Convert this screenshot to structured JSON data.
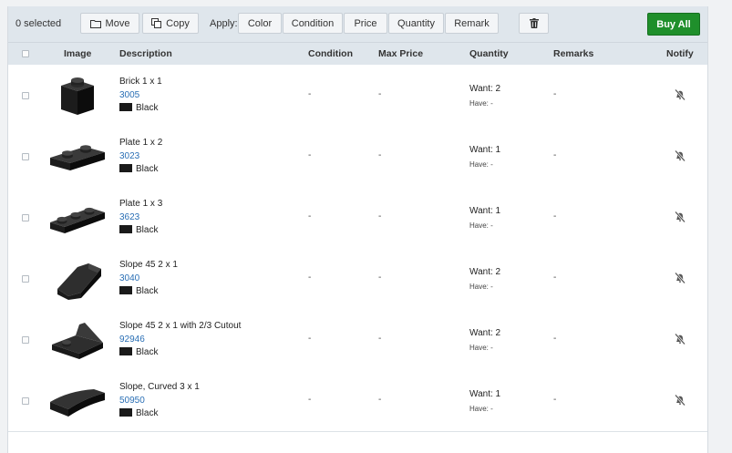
{
  "toolbar": {
    "selected_count": "0 selected",
    "move_label": "Move",
    "copy_label": "Copy",
    "apply_label": "Apply:",
    "apply_buttons": [
      "Color",
      "Condition",
      "Price",
      "Quantity",
      "Remark"
    ],
    "buy_all_label": "Buy All"
  },
  "columns": {
    "image": "Image",
    "description": "Description",
    "condition": "Condition",
    "max_price": "Max Price",
    "quantity": "Quantity",
    "remarks": "Remarks",
    "notify": "Notify"
  },
  "rows": [
    {
      "name": "Brick 1 x 1",
      "id": "3005",
      "color": "Black",
      "condition": "-",
      "max_price": "-",
      "want": "Want: 2",
      "have": "Have: -",
      "remarks": "-"
    },
    {
      "name": "Plate 1 x 2",
      "id": "3023",
      "color": "Black",
      "condition": "-",
      "max_price": "-",
      "want": "Want: 1",
      "have": "Have: -",
      "remarks": "-"
    },
    {
      "name": "Plate 1 x 3",
      "id": "3623",
      "color": "Black",
      "condition": "-",
      "max_price": "-",
      "want": "Want: 1",
      "have": "Have: -",
      "remarks": "-"
    },
    {
      "name": "Slope 45 2 x 1",
      "id": "3040",
      "color": "Black",
      "condition": "-",
      "max_price": "-",
      "want": "Want: 2",
      "have": "Have: -",
      "remarks": "-"
    },
    {
      "name": "Slope 45 2 x 1 with 2/3 Cutout",
      "id": "92946",
      "color": "Black",
      "condition": "-",
      "max_price": "-",
      "want": "Want: 2",
      "have": "Have: -",
      "remarks": "-"
    },
    {
      "name": "Slope, Curved 3 x 1",
      "id": "50950",
      "color": "Black",
      "condition": "-",
      "max_price": "-",
      "want": "Want: 1",
      "have": "Have: -",
      "remarks": "-"
    }
  ],
  "icons": {
    "move": "folder-icon",
    "copy": "copy-icon",
    "delete": "trash-icon",
    "notify": "bell-off-icon"
  },
  "colors": {
    "buy_all": "#1f8f2b",
    "part_id_link": "#2a6fb5",
    "black_swatch": "#1a1a1a"
  }
}
